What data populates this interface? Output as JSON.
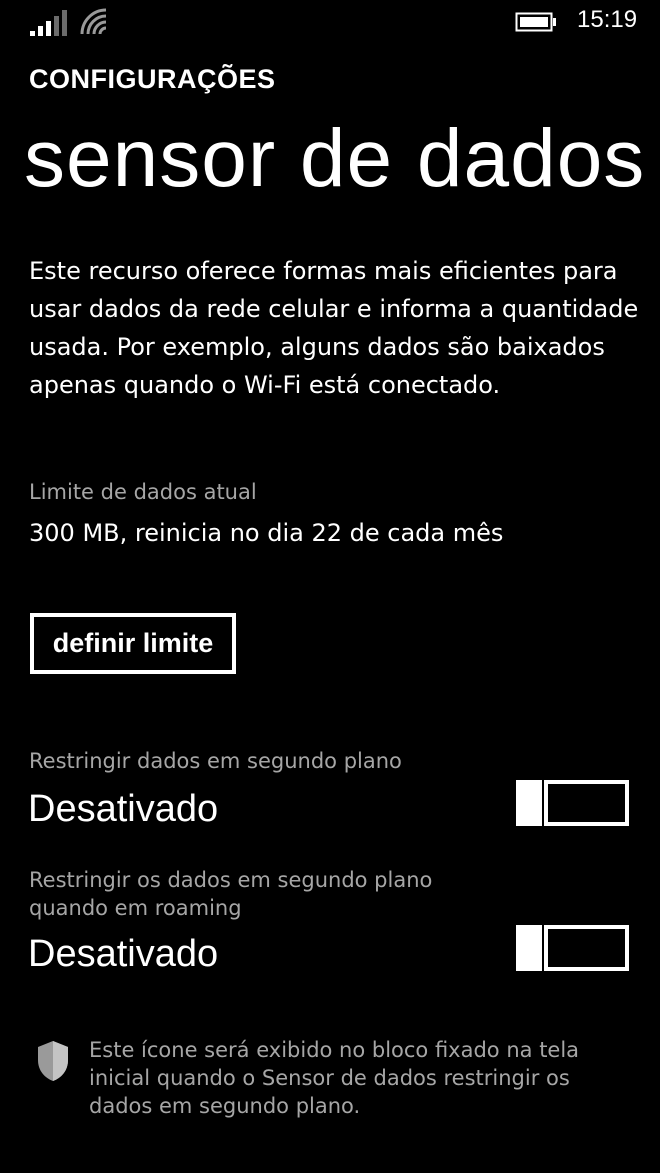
{
  "status_bar": {
    "time": "15:19",
    "icons": [
      "signal-strength-icon",
      "wifi-icon",
      "battery-icon"
    ]
  },
  "header": {
    "app_title": "CONFIGURAÇÕES",
    "page_title": "sensor de dados"
  },
  "description": "Este recurso oferece formas mais eficientes para usar dados da rede celular e informa a quantidade usada. Por exemplo, alguns dados são baixados apenas quando o Wi-Fi está conectado.",
  "data_limit": {
    "label": "Limite de dados atual",
    "value": "300 MB, reinicia no dia 22 de cada mês",
    "button_label": "definir limite"
  },
  "settings": [
    {
      "label": "Restringir dados em segundo plano",
      "value": "Desativado",
      "toggle_on": false
    },
    {
      "label": "Restringir os dados em segundo plano quando em roaming",
      "value": "Desativado",
      "toggle_on": false
    }
  ],
  "footer": {
    "icon": "shield-icon",
    "note": "Este ícone será exibido no bloco fixado na tela inicial quando o Sensor de dados restringir os dados em segundo plano."
  },
  "colors": {
    "background": "#000000",
    "foreground": "#ffffff",
    "subtle_text": "#a6a6a6"
  }
}
